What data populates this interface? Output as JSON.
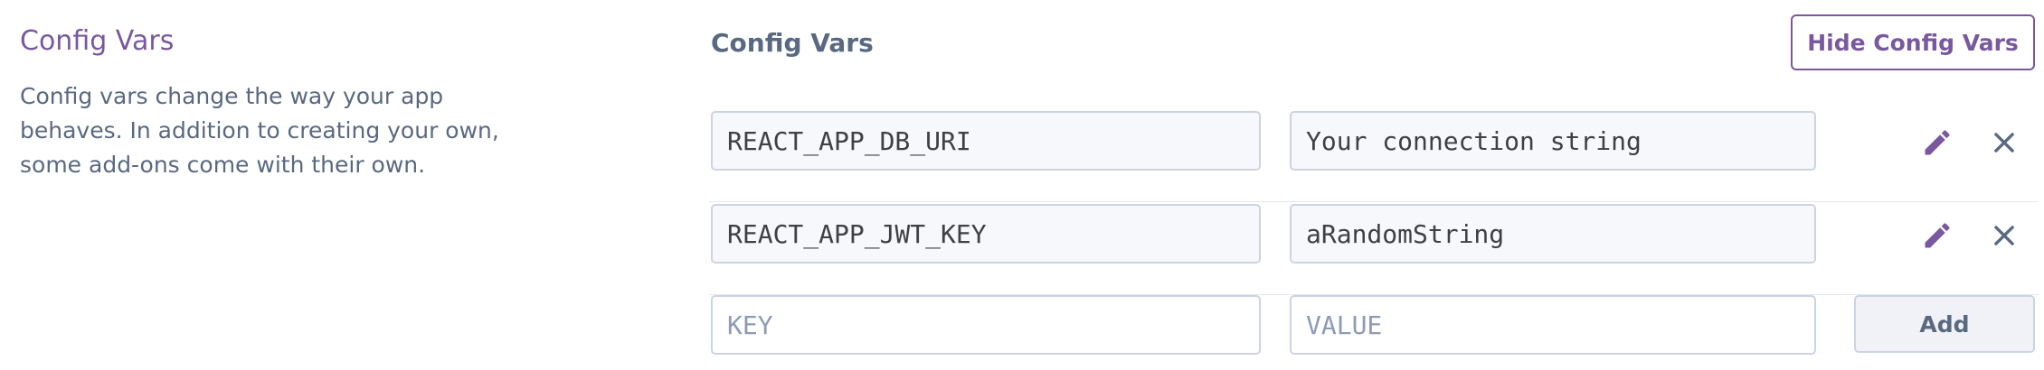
{
  "section": {
    "title": "Config Vars",
    "description": "Config vars change the way your app behaves. In addition to creating your own, some add-ons come with their own."
  },
  "panel": {
    "title": "Config Vars",
    "hide_button_label": "Hide Config Vars"
  },
  "vars": [
    {
      "key": "REACT_APP_DB_URI",
      "value": "Your connection string"
    },
    {
      "key": "REACT_APP_JWT_KEY",
      "value": "aRandomString"
    }
  ],
  "new_var": {
    "key_placeholder": "KEY",
    "value_placeholder": "VALUE",
    "add_label": "Add"
  },
  "colors": {
    "accent": "#79589f",
    "muted_text": "#596981",
    "field_border": "#ccd3e2"
  },
  "icons": {
    "edit": "pencil-icon",
    "remove": "close-icon"
  }
}
